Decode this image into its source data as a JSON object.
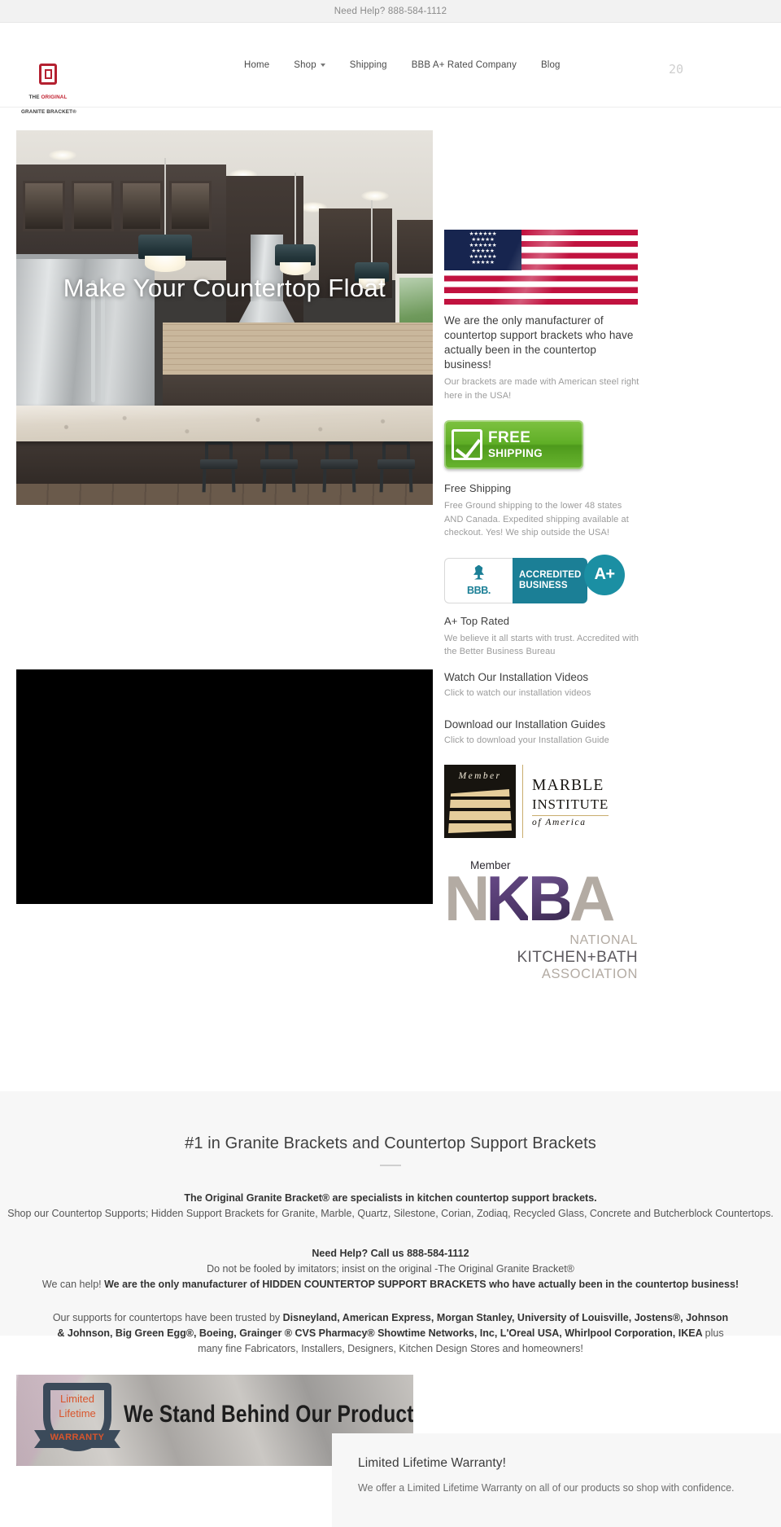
{
  "topbar": {
    "notice": "Need Help? 888-584-1112"
  },
  "header": {
    "logo": {
      "line1_pre": "THE ",
      "line1_accent": "ORIGINAL",
      "line2": "GRANITE BRACKET®",
      "icon": "square-bracket-logo-icon"
    },
    "nav": [
      {
        "label": "Home",
        "has_caret": false
      },
      {
        "label": "Shop",
        "has_caret": true
      },
      {
        "label": "Shipping",
        "has_caret": false
      },
      {
        "label": "BBB A+ Rated Company",
        "has_caret": false
      },
      {
        "label": "Blog",
        "has_caret": false
      }
    ],
    "cart_glyph": "20"
  },
  "hero": {
    "title": "Make Your Countertop Float",
    "image_alt": "modern kitchen with granite island and pendant lights"
  },
  "sidebar": {
    "usa": {
      "image_alt": "United States flag",
      "heading": "We are the only manufacturer of countertop support brackets who have actually been in the countertop business!",
      "text": "Our brackets are made with American steel right here in the USA!"
    },
    "shipping": {
      "badge_line1": "FREE",
      "badge_line2": "SHIPPING",
      "heading": "Free Shipping",
      "text": "Free Ground shipping to the lower 48 states AND Canada. Expedited shipping available at checkout. Yes!  We ship outside the USA!"
    },
    "bbb": {
      "bbb_label": "BBB.",
      "accredited_line1": "ACCREDITED",
      "accredited_line2": "BUSINESS",
      "grade": "A+",
      "heading": "A+ Top Rated",
      "text": "We believe it all starts with trust. Accredited with the Better Business Bureau"
    },
    "videos": {
      "heading": "Watch Our Installation Videos",
      "text": "Click to watch our installation videos"
    },
    "guides": {
      "heading": "Download our Installation Guides",
      "text": "Click to download your Installation Guide"
    },
    "mia": {
      "member": "Member",
      "word1": "MARBLE",
      "word2": "INSTITUTE",
      "word3": "of America"
    },
    "nkba": {
      "member": "Member",
      "letter_n": "N",
      "letter_k": "K",
      "letter_b": "B",
      "letter_a": "A",
      "sub1": "NATIONAL",
      "sub2": "KITCHEN+BATH",
      "sub3": "ASSOCIATION"
    }
  },
  "about": {
    "heading": "#1 in Granite Brackets and Countertop Support Brackets",
    "p1_bold": "The Original Granite Bracket® are specialists in kitchen countertop support brackets.",
    "p1_rest": "Shop our Countertop Supports; Hidden Support Brackets for Granite, Marble, Quartz, Silestone, Corian, Zodiaq, Recycled Glass, Concrete and Butcherblock Countertops.",
    "p2_bold": "Need Help? Call us 888-584-1112",
    "p2_line2": "Do not be fooled by imitators; insist on the original -The Original Granite Bracket®",
    "p2_line3_pre": "We can help! ",
    "p2_line3_bold": "We are the only manufacturer of HIDDEN COUNTERTOP SUPPORT BRACKETS who have actually been in the countertop business!",
    "p3_pre": "Our supports for countertops have been trusted by ",
    "p3_brands": "Disneyland, American Express, Morgan Stanley, University of Louisville, Jostens®, Johnson & Johnson, Big Green Egg®, Boeing, Grainger ® CVS Pharmacy® Showtime Networks, Inc, L'Oreal USA, Whirlpool Corporation, IKEA ",
    "p3_post": "plus many fine Fabricators, Installers, Designers, Kitchen Design Stores and homeowners!"
  },
  "warranty": {
    "badge_line1": "Limited",
    "badge_line2": "Lifetime",
    "badge_line3": "WARRANTY",
    "banner_headline": "We Stand Behind Our Products!",
    "card_heading": "Limited Lifetime Warranty!",
    "card_text": "We offer a Limited Lifetime Warranty on all of our products so shop with confidence."
  },
  "colors": {
    "brand_red": "#b42030",
    "bbb_teal": "#1b7f96",
    "shipping_green": "#5fae26",
    "warranty_orange": "#d9552c",
    "nkba_purple": "#5a3f80",
    "section_bg": "#f7f7f7"
  }
}
